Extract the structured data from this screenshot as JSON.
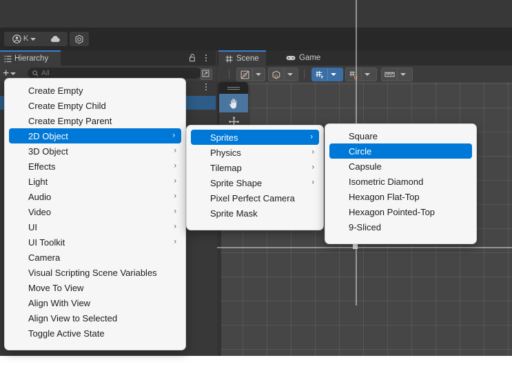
{
  "app": {
    "toolbar": {
      "account_label": "K",
      "account_icon": "person-circle-icon",
      "cloud_icon": "cloud-icon",
      "package_icon": "unity-package-icon",
      "dropdown_icon": "chevron-down-icon"
    }
  },
  "hierarchy": {
    "tab_label": "Hierarchy",
    "tab_icon": "hierarchy-icon",
    "lock_icon": "lock-open-icon",
    "menu_icon": "kebab-menu-icon",
    "add_label": "+",
    "add_dropdown_icon": "chevron-down-icon",
    "search": {
      "placeholder": "All",
      "icon": "search-icon"
    },
    "expand_icon": "expand-panel-icon"
  },
  "scene": {
    "tabs": [
      {
        "label": "Scene",
        "icon": "scene-grid-icon",
        "active": true
      },
      {
        "label": "Game",
        "icon": "gamepad-icon",
        "active": false
      }
    ],
    "toolbar": [
      {
        "name": "draw-mode-dropdown",
        "icon": "shaded-mode-icon",
        "active": false
      },
      {
        "name": "2d-3d-toggle-dropdown",
        "icon": "cube-gizmo-icon",
        "active": false
      },
      {
        "name": "grid-axis-dropdown",
        "icon": "grid-y-axis-icon",
        "active": true
      },
      {
        "name": "grid-snap-dropdown",
        "icon": "grid-snap-icon",
        "active": false
      },
      {
        "name": "component-tools-dropdown",
        "icon": "ruler-icon",
        "active": false
      }
    ],
    "palette": {
      "handle_icon": "drag-handle-icon",
      "tools": [
        {
          "name": "hand-tool",
          "icon": "hand-icon",
          "active": true
        },
        {
          "name": "move-tool",
          "icon": "move-arrows-icon",
          "active": false
        }
      ]
    }
  },
  "menus": {
    "root": {
      "items": [
        {
          "label": "Create Empty",
          "submenu": false,
          "highlighted": false
        },
        {
          "label": "Create Empty Child",
          "submenu": false,
          "highlighted": false
        },
        {
          "label": "Create Empty Parent",
          "submenu": false,
          "highlighted": false
        },
        {
          "label": "2D Object",
          "submenu": true,
          "highlighted": true
        },
        {
          "label": "3D Object",
          "submenu": true,
          "highlighted": false
        },
        {
          "label": "Effects",
          "submenu": true,
          "highlighted": false
        },
        {
          "label": "Light",
          "submenu": true,
          "highlighted": false
        },
        {
          "label": "Audio",
          "submenu": true,
          "highlighted": false
        },
        {
          "label": "Video",
          "submenu": true,
          "highlighted": false
        },
        {
          "label": "UI",
          "submenu": true,
          "highlighted": false
        },
        {
          "label": "UI Toolkit",
          "submenu": true,
          "highlighted": false
        },
        {
          "label": "Camera",
          "submenu": false,
          "highlighted": false
        },
        {
          "label": "Visual Scripting Scene Variables",
          "submenu": false,
          "highlighted": false
        },
        {
          "label": "Move To View",
          "submenu": false,
          "highlighted": false
        },
        {
          "label": "Align With View",
          "submenu": false,
          "highlighted": false
        },
        {
          "label": "Align View to Selected",
          "submenu": false,
          "highlighted": false
        },
        {
          "label": "Toggle Active State",
          "submenu": false,
          "highlighted": false
        }
      ]
    },
    "submenu_2d": {
      "items": [
        {
          "label": "Sprites",
          "submenu": true,
          "highlighted": true
        },
        {
          "label": "Physics",
          "submenu": true,
          "highlighted": false
        },
        {
          "label": "Tilemap",
          "submenu": true,
          "highlighted": false
        },
        {
          "label": "Sprite Shape",
          "submenu": true,
          "highlighted": false
        },
        {
          "label": "Pixel Perfect Camera",
          "submenu": false,
          "highlighted": false
        },
        {
          "label": "Sprite Mask",
          "submenu": false,
          "highlighted": false
        }
      ]
    },
    "submenu_sprites": {
      "items": [
        {
          "label": "Square",
          "submenu": false,
          "highlighted": false
        },
        {
          "label": "Circle",
          "submenu": false,
          "highlighted": true
        },
        {
          "label": "Capsule",
          "submenu": false,
          "highlighted": false
        },
        {
          "label": "Isometric Diamond",
          "submenu": false,
          "highlighted": false
        },
        {
          "label": "Hexagon Flat-Top",
          "submenu": false,
          "highlighted": false
        },
        {
          "label": "Hexagon Pointed-Top",
          "submenu": false,
          "highlighted": false
        },
        {
          "label": "9-Sliced",
          "submenu": false,
          "highlighted": false
        }
      ]
    },
    "submenu_arrow_glyph": "›"
  },
  "colors": {
    "accent_blue": "#0078d7",
    "tab_underline": "#3a7fd5",
    "panel_dark": "#383838",
    "scene_bg": "#464646",
    "selection_row": "#2c5c87"
  }
}
